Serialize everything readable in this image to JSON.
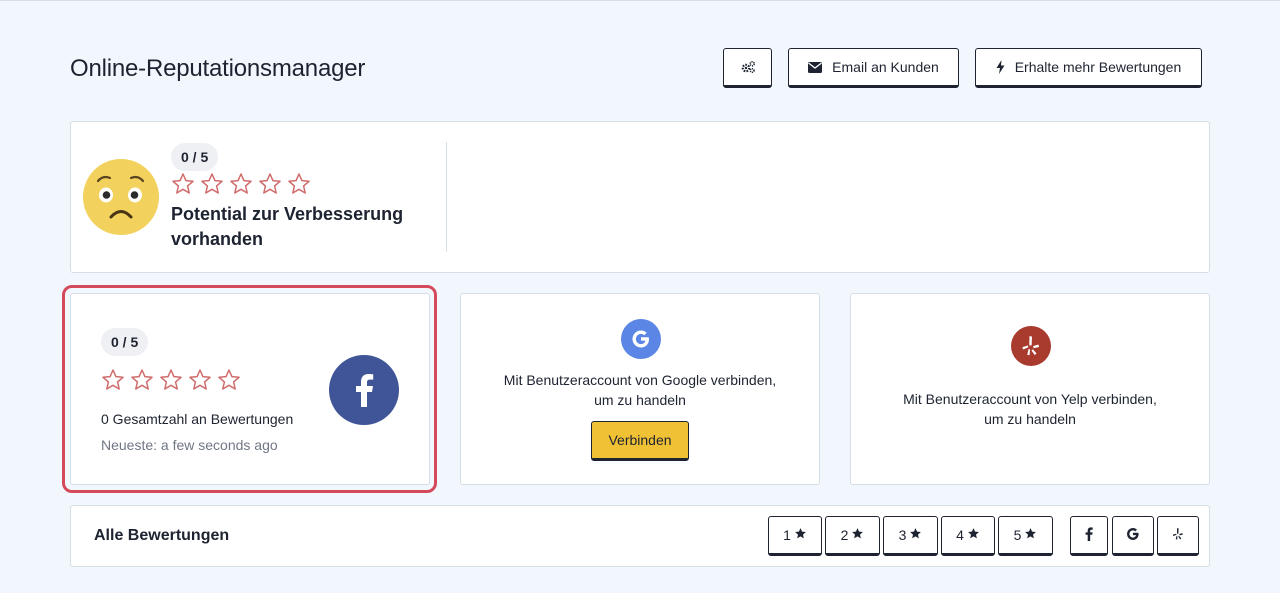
{
  "page_title": "Online-Reputationsmanager",
  "toolbar": {
    "settings_icon": "gears-icon",
    "email_label": "Email an Kunden",
    "email_icon": "envelope-icon",
    "more_reviews_label": "Erhalte mehr Bewertungen",
    "more_reviews_icon": "bolt-icon"
  },
  "summary": {
    "rating_badge": "0 / 5",
    "rating_value": 0,
    "rating_max": 5,
    "status_text": "Potential zur Verbesserung vorhanden",
    "emoji": "worried-face-icon"
  },
  "facebook_card": {
    "rating_badge": "0 / 5",
    "rating_value": 0,
    "total_reviews": "0 Gesamtzahl an Bewertungen",
    "latest": "Neueste: a few seconds ago",
    "icon": "facebook-icon"
  },
  "google_card": {
    "text_line1": "Mit Benutzeraccount von Google verbinden,",
    "text_line2": "um zu handeln",
    "connect_label": "Verbinden",
    "icon": "google-icon"
  },
  "yelp_card": {
    "text_line1": "Mit Benutzeraccount von Yelp verbinden,",
    "text_line2": "um zu handeln",
    "icon": "yelp-icon"
  },
  "all_reviews": {
    "title": "Alle Bewertungen",
    "star_filters": [
      "1",
      "2",
      "3",
      "4",
      "5"
    ],
    "source_filters": [
      "facebook-icon",
      "google-icon",
      "yelp-icon"
    ]
  },
  "colors": {
    "background": "#f2f7fd",
    "star_outline": "#cf6b6b",
    "facebook_blue": "#3f5597",
    "google_blue": "#5b86e5",
    "yelp_red": "#a83a2e",
    "connect_yellow": "#f0c135",
    "highlight_red": "#d44a5a"
  }
}
